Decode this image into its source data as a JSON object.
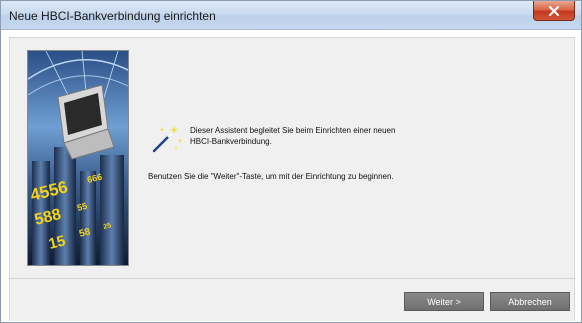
{
  "window": {
    "title": "Neue HBCI-Bankverbindung einrichten",
    "close_symbol": "x"
  },
  "main": {
    "intro_line1": "Dieser Assistent begleitet Sie beim Einrichten einer neuen",
    "intro_line2": "HBCI-Bankverbindung.",
    "hint": "Benutzen Sie die \"Weiter\"-Taste, um mit der Einrichtung zu beginnen.",
    "wizard_icon": "magic-wand-icon",
    "side_image_numbers": [
      "4556",
      "666",
      "588",
      "55",
      "15",
      "58",
      "25"
    ]
  },
  "buttons": {
    "next_label": "Weiter >",
    "cancel_label": "Abbrechen"
  },
  "colors": {
    "close_button": "#c4381d",
    "button_bg": "#7b7b7b",
    "panel_bg": "#f0f0f0",
    "digits": "#f2d21a"
  }
}
